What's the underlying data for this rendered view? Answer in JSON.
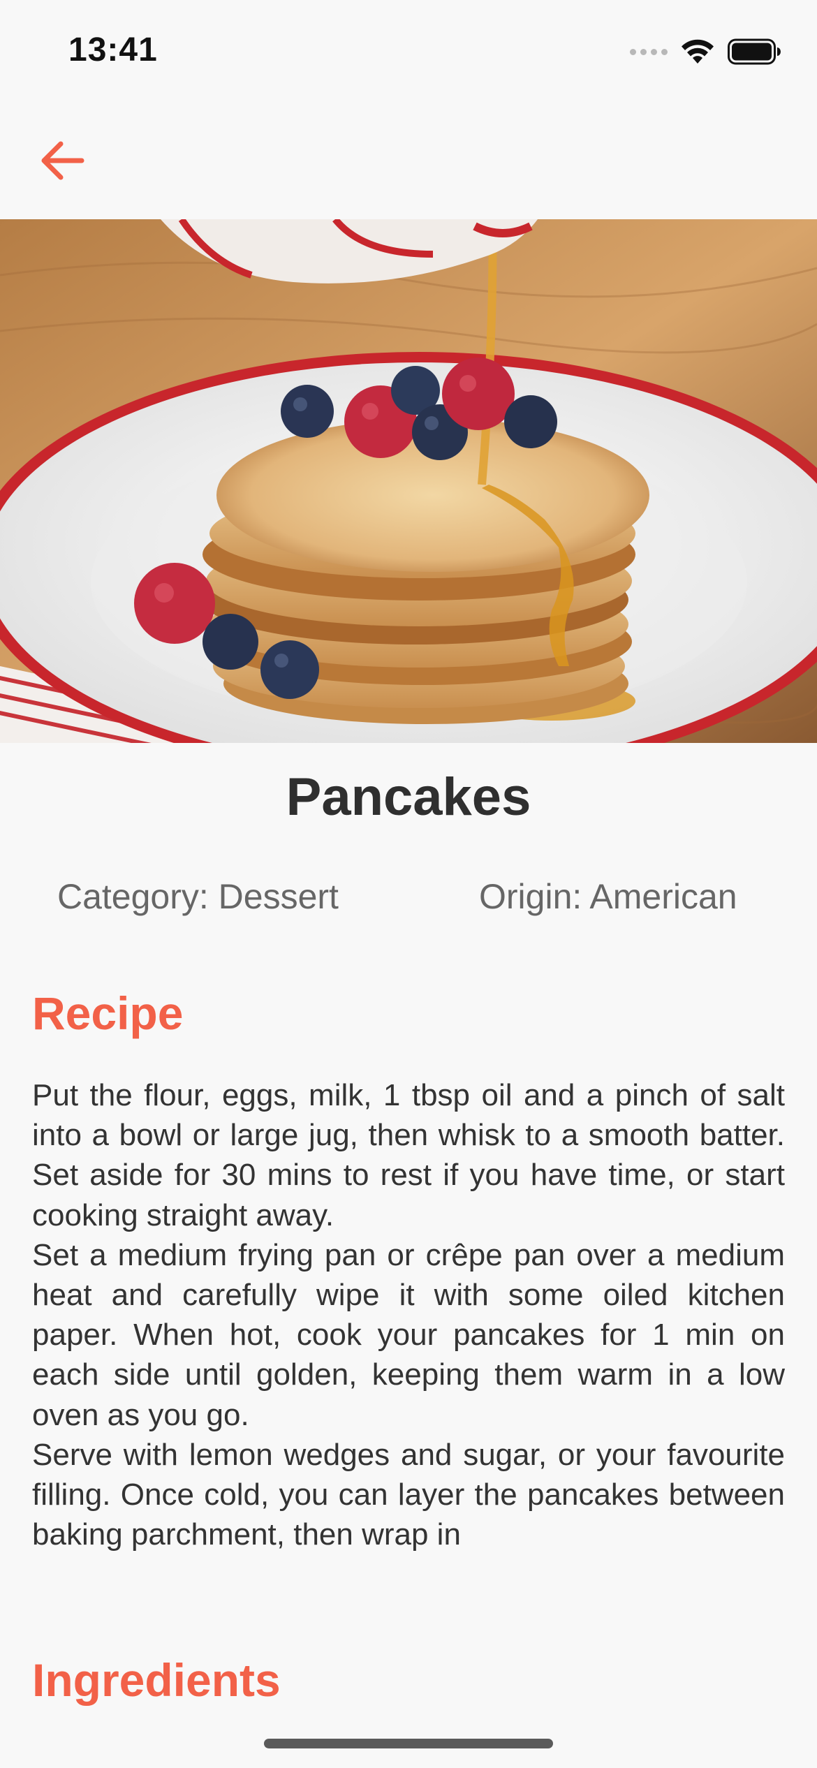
{
  "status_bar": {
    "time": "13:41"
  },
  "nav": {
    "back_icon": "arrow-left-icon",
    "accent_color": "#f26148"
  },
  "hero_image": {
    "description_icon": "pancakes-photo"
  },
  "meal": {
    "title": "Pancakes",
    "category_text": "Category: Dessert",
    "origin_text": "Origin: American"
  },
  "sections": {
    "recipe_heading": "Recipe",
    "ingredients_heading": "Ingredients"
  },
  "instructions": [
    "Put the flour, eggs, milk, 1 tbsp oil and a pinch of salt into a bowl or large jug, then whisk to a smooth batter. Set aside for 30 mins to rest if you have time, or start cooking straight away.",
    "Set a medium frying pan or crêpe pan over a medium heat and carefully wipe it with some oiled kitchen paper. When hot, cook your pancakes for 1 min on each side until golden, keeping them warm in a low oven as you go.",
    "Serve with lemon wedges and sugar, or your favourite filling. Once cold, you can layer the pancakes between baking parchment, then wrap in"
  ]
}
